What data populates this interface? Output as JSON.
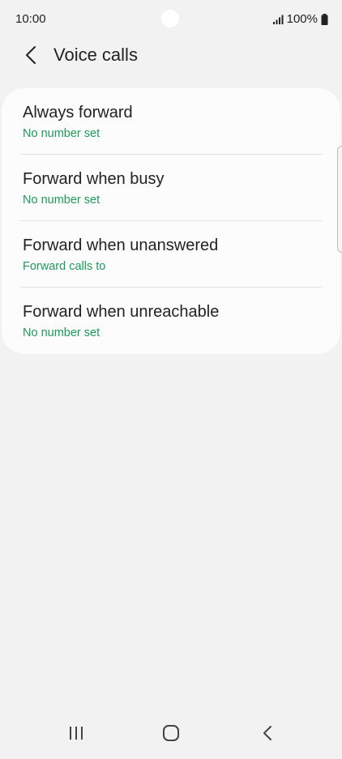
{
  "status_bar": {
    "time": "10:00",
    "battery_percent": "100%",
    "icons": [
      "signal-icon",
      "battery-icon"
    ]
  },
  "header": {
    "title": "Voice calls",
    "back_icon": "back-arrow-icon"
  },
  "forwarding": {
    "items": [
      {
        "title": "Always forward",
        "subtitle": "No number set"
      },
      {
        "title": "Forward when busy",
        "subtitle": "No number set"
      },
      {
        "title": "Forward when unanswered",
        "subtitle": "Forward calls to"
      },
      {
        "title": "Forward when unreachable",
        "subtitle": "No number set"
      }
    ]
  },
  "nav_bar": {
    "icons": [
      "recents-icon",
      "home-icon",
      "back-icon"
    ]
  },
  "colors": {
    "background": "#f2f2f2",
    "card": "#fcfcfc",
    "accent_green": "#1e9a5a",
    "text": "#222222"
  }
}
